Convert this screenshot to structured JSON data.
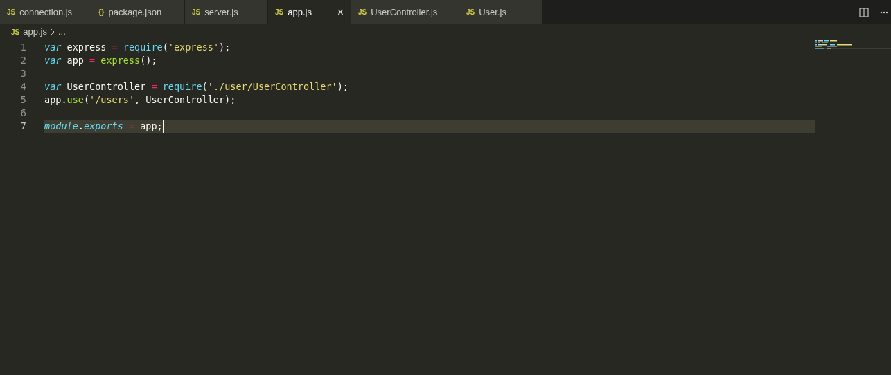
{
  "tabs": [
    {
      "icon": "JS",
      "kind": "js",
      "label": "connection.js",
      "selected": false
    },
    {
      "icon": "{}",
      "kind": "json",
      "label": "package.json",
      "selected": false
    },
    {
      "icon": "JS",
      "kind": "js",
      "label": "server.js",
      "selected": false
    },
    {
      "icon": "JS",
      "kind": "js",
      "label": "app.js",
      "selected": true,
      "close": "×"
    },
    {
      "icon": "JS",
      "kind": "js",
      "label": "UserController.js",
      "selected": false
    },
    {
      "icon": "JS",
      "kind": "js",
      "label": "User.js",
      "selected": false
    }
  ],
  "breadcrumb": {
    "icon": "JS",
    "file": "app.js",
    "more": "..."
  },
  "editor": {
    "lines": [
      {
        "number": "1",
        "current": false,
        "tokens": [
          {
            "kind": "keyword",
            "text": "var"
          },
          {
            "kind": "plain",
            "text": " express "
          },
          {
            "kind": "operator",
            "text": "="
          },
          {
            "kind": "builtin",
            "text": " require"
          },
          {
            "kind": "plain",
            "text": "("
          },
          {
            "kind": "string",
            "text": "'express'"
          },
          {
            "kind": "plain",
            "text": ");"
          }
        ]
      },
      {
        "number": "2",
        "current": false,
        "tokens": [
          {
            "kind": "keyword",
            "text": "var"
          },
          {
            "kind": "plain",
            "text": " app "
          },
          {
            "kind": "operator",
            "text": "="
          },
          {
            "kind": "function",
            "text": " express"
          },
          {
            "kind": "plain",
            "text": "();"
          }
        ]
      },
      {
        "number": "3",
        "current": false
      },
      {
        "number": "4",
        "current": false,
        "tokens": [
          {
            "kind": "keyword",
            "text": "var"
          },
          {
            "kind": "plain",
            "text": " UserController "
          },
          {
            "kind": "operator",
            "text": "="
          },
          {
            "kind": "builtin",
            "text": " require"
          },
          {
            "kind": "plain",
            "text": "("
          },
          {
            "kind": "string",
            "text": "'./user/UserController'"
          },
          {
            "kind": "plain",
            "text": ");"
          }
        ]
      },
      {
        "number": "5",
        "current": false,
        "tokens": [
          {
            "kind": "plain",
            "text": "app."
          },
          {
            "kind": "function",
            "text": "use"
          },
          {
            "kind": "plain",
            "text": "("
          },
          {
            "kind": "string",
            "text": "'/users'"
          },
          {
            "kind": "plain",
            "text": ", UserController);"
          }
        ]
      },
      {
        "number": "6",
        "current": false
      },
      {
        "number": "7",
        "current": true,
        "tokens": [
          {
            "kind": "keyword",
            "text": "module"
          },
          {
            "kind": "plain",
            "text": "."
          },
          {
            "kind": "keyword",
            "text": "exports"
          },
          {
            "kind": "operator",
            "text": " ="
          },
          {
            "kind": "plain",
            "text": " app;"
          }
        ]
      }
    ]
  }
}
